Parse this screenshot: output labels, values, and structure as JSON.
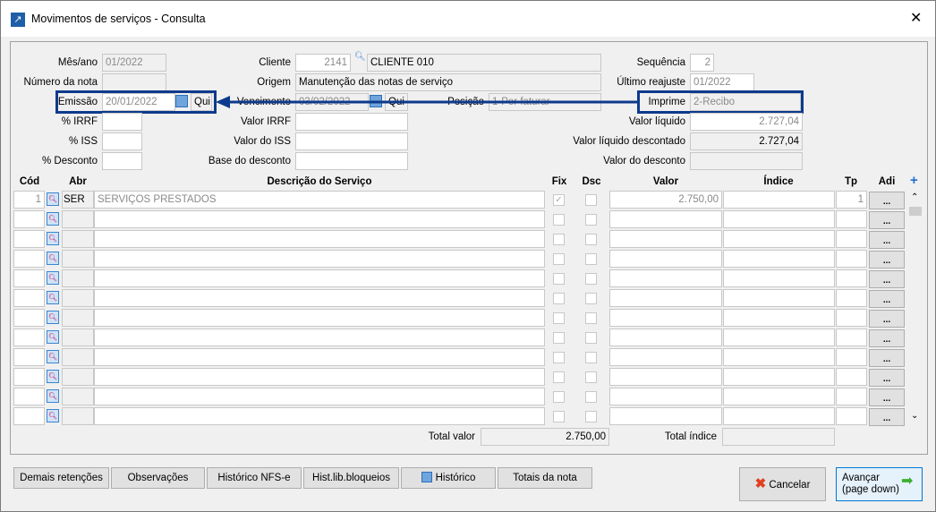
{
  "window": {
    "title": "Movimentos de serviços - Consulta",
    "close": "✕"
  },
  "form": {
    "mes_ano_label": "Mês/ano",
    "mes_ano": "01/2022",
    "numero_nota_label": "Número da nota",
    "numero_nota": "",
    "emissao_label": "Emissão",
    "emissao": "20/01/2022",
    "emissao_dia": "Qui",
    "irrf_pct_label": "% IRRF",
    "iss_pct_label": "% ISS",
    "desconto_pct_label": "% Desconto",
    "cliente_label": "Cliente",
    "cliente_codigo": "2141",
    "cliente_nome": "CLIENTE 010",
    "origem_label": "Origem",
    "origem": "Manutenção das notas de serviço",
    "vencimento_label": "Vencimento",
    "vencimento": "03/02/2022",
    "vencimento_dia": "Qui",
    "posicao_label": "Posição",
    "posicao": "1-Por faturar",
    "valor_irrf_label": "Valor IRRF",
    "valor_iss_label": "Valor do ISS",
    "base_desconto_label": "Base do desconto",
    "sequencia_label": "Sequência",
    "sequencia": "2",
    "ultimo_reajuste_label": "Último reajuste",
    "ultimo_reajuste": "01/2022",
    "imprime_label": "Imprime",
    "imprime": "2-Recibo",
    "valor_liquido_label": "Valor líquido",
    "valor_liquido": "2.727,04",
    "valor_liquido_desc_label": "Valor líquido descontado",
    "valor_liquido_desc": "2.727,04",
    "valor_desconto_label": "Valor do desconto",
    "valor_desconto": ""
  },
  "grid": {
    "headers": [
      "Cód",
      "Abr",
      "Descrição do Serviço",
      "Fix",
      "Dsc",
      "Valor",
      "Índice",
      "Tp",
      "Adi"
    ],
    "rows": [
      {
        "cod": "1",
        "abr": "SER",
        "desc": "SERVIÇOS PRESTADOS",
        "fix": true,
        "dsc": false,
        "valor": "2.750,00",
        "indice": "",
        "tp": "1"
      },
      {},
      {},
      {},
      {},
      {},
      {},
      {},
      {},
      {},
      {},
      {}
    ],
    "adi_label": "..."
  },
  "totals": {
    "total_valor_label": "Total valor",
    "total_valor": "2.750,00",
    "total_indice_label": "Total índice",
    "total_indice": ""
  },
  "buttons": {
    "demais": "Demais retenções",
    "observacoes": "Observações",
    "historico_nfse": "Histórico NFS-e",
    "hist_lib": "Hist.lib.bloqueios",
    "historico": "Histórico",
    "totais": "Totais da nota",
    "cancelar": "Cancelar",
    "avancar": "Avançar",
    "avancar_sub": "(page down)"
  },
  "colors": {
    "highlight": "#0d3a8c",
    "arrow": "#0d3a8c"
  }
}
